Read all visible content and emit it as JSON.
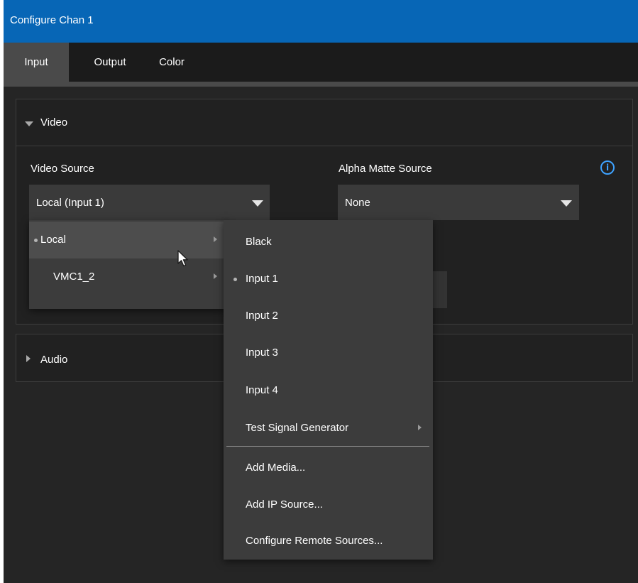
{
  "window": {
    "title": "Configure Chan 1"
  },
  "tabs": [
    {
      "label": "Input",
      "active": true
    },
    {
      "label": "Output",
      "active": false
    },
    {
      "label": "Color",
      "active": false
    }
  ],
  "video_section": {
    "title": "Video",
    "expanded": true,
    "video_source": {
      "label": "Video Source",
      "value": "Local (Input 1)"
    },
    "alpha_matte_source": {
      "label": "Alpha Matte Source",
      "value": "None"
    },
    "info_icon": "i"
  },
  "audio_section": {
    "title": "Audio",
    "expanded": false
  },
  "source_menu": {
    "items": [
      {
        "label": "Local",
        "selected": true,
        "hover": true,
        "submenu": true
      },
      {
        "label": "VMC1_2",
        "selected": false,
        "hover": false,
        "submenu": true
      }
    ]
  },
  "local_submenu": {
    "items": [
      {
        "label": "Black",
        "selected": false
      },
      {
        "label": "Input 1",
        "selected": true
      },
      {
        "label": "Input 2",
        "selected": false
      },
      {
        "label": "Input 3",
        "selected": false
      },
      {
        "label": "Input 4",
        "selected": false
      },
      {
        "label": "Test Signal Generator",
        "selected": false,
        "submenu": true
      }
    ],
    "actions": [
      {
        "label": "Add Media..."
      },
      {
        "label": "Add IP Source..."
      },
      {
        "label": "Configure Remote Sources..."
      }
    ]
  },
  "colors": {
    "title_bar": "#0766b6",
    "info_accent": "#3ea2ff",
    "background": "#252525"
  }
}
